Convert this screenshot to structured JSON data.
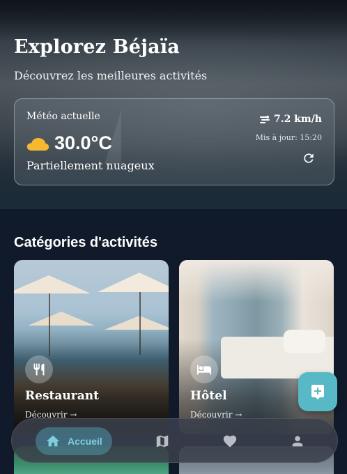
{
  "hero": {
    "title": "Explorez Béjaïa",
    "subtitle": "Découvrez les meilleures activités"
  },
  "weather": {
    "label": "Météo actuelle",
    "icon": "cloud-sun-icon",
    "temperature": "30.0°C",
    "condition": "Partiellement nuageux",
    "wind": "7.2 km/h",
    "wind_icon": "wind-icon",
    "updated": "Mis à jour: 15:20",
    "refresh_icon": "refresh-icon"
  },
  "categories": {
    "heading": "Catégories d'activités",
    "items": [
      {
        "name": "Restaurant",
        "link": "Découvrir →",
        "icon": "restaurant-icon"
      },
      {
        "name": "Hôtel",
        "link": "Découvrir →",
        "icon": "hotel-bed-icon"
      }
    ]
  },
  "fab": {
    "icon": "add-location-icon"
  },
  "bottom_nav": {
    "items": [
      {
        "label": "Accueil",
        "icon": "home-icon",
        "active": true
      },
      {
        "label": "",
        "icon": "map-icon",
        "active": false
      },
      {
        "label": "",
        "icon": "heart-icon",
        "active": false
      },
      {
        "label": "",
        "icon": "person-icon",
        "active": false
      }
    ]
  },
  "colors": {
    "background": "#111a2b",
    "accent": "#57b9c6",
    "nav_active_text": "#7fd0dd",
    "sun": "#f5b82e"
  }
}
